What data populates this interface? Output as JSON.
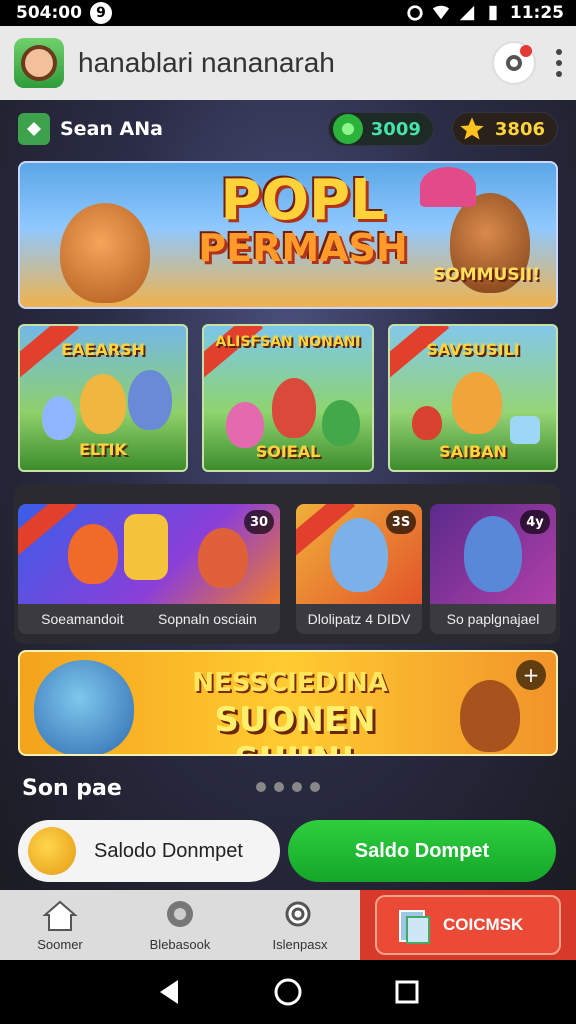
{
  "status_bar": {
    "time_left": "504:00",
    "notification": "9",
    "clock": "11:25"
  },
  "app_bar": {
    "title": "hanablari nananarah"
  },
  "user": {
    "name": "Sean ANa",
    "gems": "3009",
    "stars": "3806"
  },
  "hero": {
    "title_line1": "POPL",
    "title_line2": "PERMASH",
    "subtitle": "SOMMUSII!"
  },
  "cards": [
    {
      "top_label": "EAEARSH",
      "bottom_label": "ELTIK"
    },
    {
      "top_label": "ALISFSAN NONANI",
      "bottom_label": "SOIEAL"
    },
    {
      "top_label": "SAVSUSILI",
      "bottom_label": "SAIBAN"
    }
  ],
  "games": [
    {
      "caption_left": "Soeamandoit",
      "caption_right": "Sopnaln osciain",
      "badge": "30"
    },
    {
      "caption": "Dlolipatz 4 DIDV",
      "badge": "3S"
    },
    {
      "caption": "So paplgnajael",
      "badge": "4y"
    }
  ],
  "promo": {
    "line1": "NESSCIEDINA",
    "line2": "SUONEN SUIIN!"
  },
  "section": {
    "title": "Son pae"
  },
  "buttons": {
    "white_label": "Salodo Donmpet",
    "green_label": "Saldo Dompet"
  },
  "bottom_nav": [
    {
      "label": "Soomer",
      "icon": "home-icon"
    },
    {
      "label": "Blebasook",
      "icon": "chat-icon"
    },
    {
      "label": "Islenpasx",
      "icon": "search-icon"
    }
  ],
  "cta": {
    "label": "COICMSK"
  },
  "colors": {
    "accent_green": "#1fb834",
    "accent_red": "#d83a2a",
    "gold": "#ffd23a"
  }
}
